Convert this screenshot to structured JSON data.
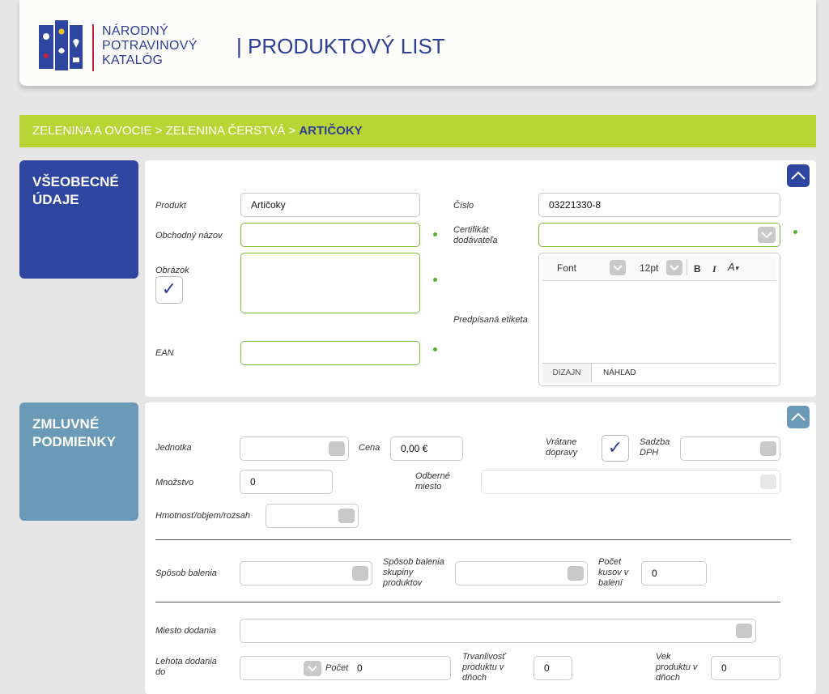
{
  "header": {
    "logo_lines": [
      "NÁRODNÝ",
      "POTRAVINOVÝ",
      "KATALÓG"
    ],
    "page_title": "| PRODUKTOVÝ LIST"
  },
  "breadcrumb": {
    "items": [
      "ZELENINA A OVOCIE",
      "ZELENINA ČERSTVÁ"
    ],
    "separator": ">",
    "current": "ARTIČOKY"
  },
  "general": {
    "title": "VŠEOBECNÉ ÚDAJE",
    "product_label": "Produkt",
    "product_value": "Artičoky",
    "trade_name_label": "Obchodný názov",
    "trade_name_value": "",
    "image_label": "Obrázok",
    "image_checked": "✓",
    "ean_label": "EAN",
    "ean_value": "",
    "number_label": "Číslo",
    "number_value": "03221330-8",
    "certificate_label": "Certifikát dodávateľa",
    "certificate_value": "",
    "label_label": "Predpísaná etiketa",
    "editor": {
      "font": "Font",
      "size": "12pt",
      "bold": "B",
      "italic": "I",
      "color": "A",
      "tab_design": "DIZAJN",
      "tab_preview": "NÁHĽAD"
    }
  },
  "contract": {
    "title": "ZMLUVNÉ PODMIENKY",
    "unit_label": "Jednotka",
    "unit_value": "",
    "price_label": "Cena",
    "price_value": "0,00 €",
    "incl_transport_label": "Vrátane dopravy",
    "incl_transport_checked": "✓",
    "vat_label": "Sadzba DPH",
    "vat_value": "",
    "quantity_label": "Množstvo",
    "quantity_value": "0",
    "pickup_label": "Odberné miesto",
    "pickup_value": "",
    "weight_label": "Hmotnosť/objem/rozsah",
    "weight_value": "",
    "packaging_label": "Spôsob balenia",
    "packaging_value": "",
    "group_packaging_label": "Spôsob balenia skupiny produktov",
    "group_packaging_value": "",
    "pieces_label": "Počet kusov v balení",
    "pieces_value": "0",
    "delivery_place_label": "Miesto dodania",
    "delivery_place_value": "",
    "delivery_time_label": "Lehota dodania do",
    "count_label": "Počet",
    "count_value": "0",
    "shelf_life_label": "Trvanlivosť produktu v dňoch",
    "shelf_life_value": "0",
    "age_label": "Vek produktu v dňoch",
    "age_value": "0"
  },
  "colors": {
    "brand_blue": "#2e46a0",
    "accent_green": "#b8d435",
    "required_green": "#7bbb3a",
    "steel_blue": "#6a9ab6"
  }
}
